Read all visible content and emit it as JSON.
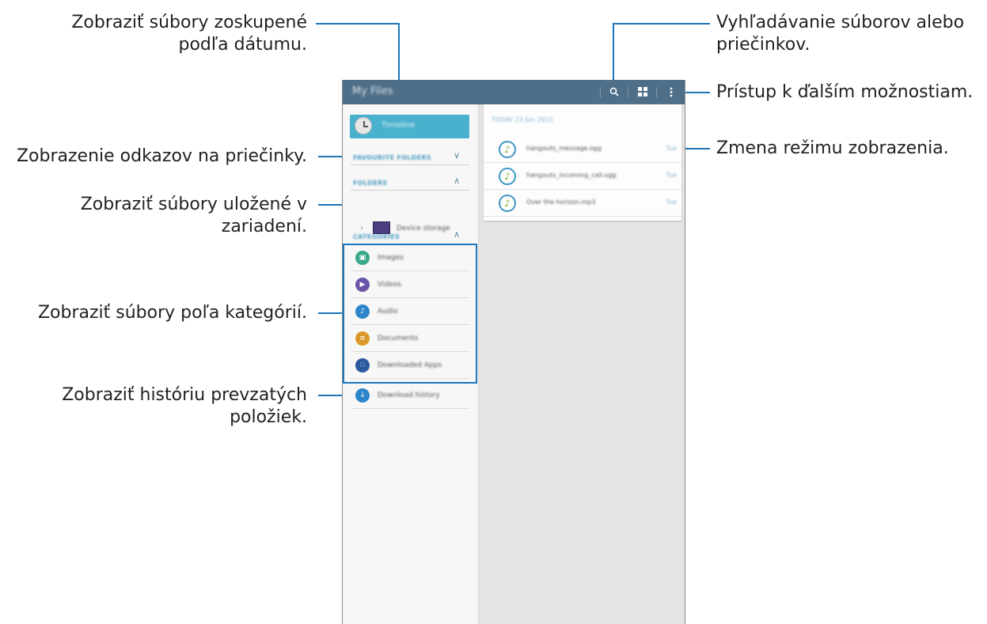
{
  "callouts": {
    "date_grouped_line1": "Zobraziť súbory zoskupené",
    "date_grouped_line2": "podľa dátumu.",
    "search_line1": "Vyhľadávanie súborov alebo",
    "search_line2": "priečinkov.",
    "more_options": "Prístup k ďalším možnostiam.",
    "folder_shortcuts": "Zobrazenie odkazov na priečinky.",
    "view_mode": "Zmena režimu zobrazenia.",
    "device_files_line1": "Zobraziť súbory uložené v",
    "device_files_line2": "zariadení.",
    "categories": "Zobraziť súbory poľa kategórií.",
    "download_history_line1": "Zobraziť históriu prevzatých",
    "download_history_line2": "položiek."
  },
  "app": {
    "title": "My Files",
    "accent": "#4f6f88",
    "highlight": "#49b0cd"
  },
  "drawer": {
    "timeline_label": "Timeline",
    "favourite_folders": "FAVOURITE FOLDERS",
    "folders": "FOLDERS",
    "device_storage": "Device storage",
    "categories_header": "CATEGORIES",
    "categories": [
      {
        "label": "Images",
        "icon": "image-icon",
        "color": "#3aa88a"
      },
      {
        "label": "Videos",
        "icon": "video-icon",
        "color": "#6a55a8"
      },
      {
        "label": "Audio",
        "icon": "audio-icon",
        "color": "#2e86c8"
      },
      {
        "label": "Documents",
        "icon": "document-icon",
        "color": "#d99a2b"
      },
      {
        "label": "Downloaded Apps",
        "icon": "apps-icon",
        "color": "#2a5aa0"
      }
    ],
    "download_history": "Download history"
  },
  "content": {
    "date_header": "TODAY 23 Jun 2015",
    "files": [
      {
        "name": "hangouts_message.ogg",
        "time": "Tue"
      },
      {
        "name": "hangouts_incoming_call.ogg",
        "time": "Tue"
      },
      {
        "name": "Over the horizon.mp3",
        "time": "Tue"
      }
    ]
  }
}
